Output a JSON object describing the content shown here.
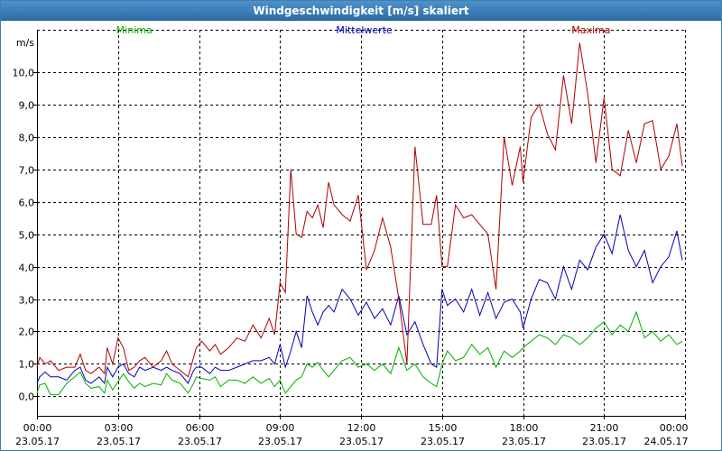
{
  "window": {
    "title": "Windgeschwindigkeit [m/s] skaliert"
  },
  "chart_data": {
    "type": "line",
    "title": "Windgeschwindigkeit [m/s] skaliert",
    "ylabel": "m/s",
    "xlabel": "",
    "ylim": [
      -0.6,
      11.3
    ],
    "xlim": [
      0,
      24
    ],
    "grid": true,
    "legend_position": "top",
    "yticks": [
      0,
      1,
      2,
      3,
      4,
      5,
      6,
      7,
      8,
      9,
      10
    ],
    "ytick_labels": [
      "0,0",
      "1,0",
      "2,0",
      "3,0",
      "4,0",
      "5,0",
      "6,0",
      "7,0",
      "8,0",
      "9,0",
      "10,0"
    ],
    "xticks": [
      0,
      3,
      6,
      9,
      12,
      15,
      18,
      21,
      24
    ],
    "xtick_labels": [
      {
        "time": "00:00",
        "date": "23.05.17"
      },
      {
        "time": "03:00",
        "date": "23.05.17"
      },
      {
        "time": "06:00",
        "date": "23.05.17"
      },
      {
        "time": "09:00",
        "date": "23.05.17"
      },
      {
        "time": "12:00",
        "date": "23.05.17"
      },
      {
        "time": "15:00",
        "date": "23.05.17"
      },
      {
        "time": "18:00",
        "date": "23.05.17"
      },
      {
        "time": "21:00",
        "date": "23.05.17"
      },
      {
        "time": "00:00",
        "date": "24.05.17"
      }
    ],
    "series": [
      {
        "name": "Minima",
        "color": "#00b000",
        "x": [
          0,
          0.1,
          0.3,
          0.5,
          0.8,
          1.1,
          1.4,
          1.6,
          1.8,
          2.0,
          2.3,
          2.5,
          2.6,
          2.8,
          3.0,
          3.2,
          3.4,
          3.6,
          3.8,
          4.0,
          4.3,
          4.6,
          4.8,
          5.0,
          5.3,
          5.6,
          5.8,
          5.9,
          6.1,
          6.4,
          6.6,
          6.8,
          7.1,
          7.4,
          7.7,
          8.0,
          8.3,
          8.6,
          8.8,
          9.0,
          9.2,
          9.4,
          9.6,
          9.8,
          10.0,
          10.2,
          10.4,
          10.6,
          10.8,
          11.0,
          11.3,
          11.6,
          11.9,
          12.2,
          12.5,
          12.8,
          13.1,
          13.4,
          13.7,
          14.0,
          14.3,
          14.6,
          14.8,
          15.0,
          15.2,
          15.5,
          15.8,
          16.1,
          16.4,
          16.7,
          17.0,
          17.3,
          17.6,
          17.9,
          18.0,
          18.3,
          18.6,
          18.9,
          19.2,
          19.5,
          19.8,
          20.1,
          20.4,
          20.7,
          21.0,
          21.3,
          21.6,
          21.9,
          22.2,
          22.5,
          22.8,
          23.1,
          23.4,
          23.7,
          23.9
        ],
        "values": [
          0.1,
          0.35,
          0.4,
          0.05,
          0.05,
          0.4,
          0.6,
          0.75,
          0.4,
          0.25,
          0.3,
          0.1,
          0.5,
          0.2,
          0.45,
          0.7,
          0.45,
          0.25,
          0.4,
          0.3,
          0.4,
          0.35,
          0.7,
          0.5,
          0.4,
          0.1,
          0.4,
          0.6,
          0.55,
          0.5,
          0.6,
          0.3,
          0.5,
          0.5,
          0.4,
          0.6,
          0.4,
          0.55,
          0.3,
          0.5,
          0.1,
          0.3,
          0.5,
          0.6,
          1.0,
          0.9,
          1.05,
          0.8,
          0.6,
          0.8,
          1.1,
          1.2,
          0.9,
          1.0,
          0.8,
          1.0,
          0.7,
          1.5,
          0.8,
          1.0,
          0.6,
          0.4,
          0.3,
          1.0,
          1.4,
          1.1,
          1.2,
          1.6,
          1.3,
          1.5,
          0.9,
          1.4,
          1.2,
          1.4,
          1.5,
          1.7,
          1.9,
          1.8,
          1.6,
          1.9,
          1.8,
          1.6,
          1.8,
          2.1,
          2.3,
          1.9,
          2.2,
          2.0,
          2.6,
          1.8,
          2.0,
          1.7,
          1.9,
          1.6,
          1.7
        ]
      },
      {
        "name": "Mittelwerte",
        "color": "#0000b8",
        "x": [
          0,
          0.1,
          0.3,
          0.5,
          0.8,
          1.1,
          1.4,
          1.6,
          1.8,
          2.0,
          2.3,
          2.5,
          2.6,
          2.8,
          3.0,
          3.2,
          3.4,
          3.6,
          3.8,
          4.0,
          4.3,
          4.6,
          4.8,
          5.0,
          5.3,
          5.6,
          5.8,
          5.9,
          6.1,
          6.4,
          6.6,
          6.8,
          7.1,
          7.4,
          7.7,
          8.0,
          8.3,
          8.6,
          8.8,
          9.0,
          9.2,
          9.4,
          9.6,
          9.8,
          10.0,
          10.2,
          10.4,
          10.6,
          10.8,
          11.0,
          11.3,
          11.6,
          11.9,
          12.2,
          12.5,
          12.8,
          13.1,
          13.4,
          13.7,
          14.0,
          14.3,
          14.6,
          14.8,
          15.0,
          15.2,
          15.5,
          15.8,
          16.1,
          16.4,
          16.7,
          17.0,
          17.3,
          17.6,
          17.9,
          18.0,
          18.3,
          18.6,
          18.9,
          19.2,
          19.5,
          19.8,
          20.1,
          20.4,
          20.7,
          21.0,
          21.3,
          21.6,
          21.9,
          22.2,
          22.5,
          22.8,
          23.1,
          23.4,
          23.7,
          23.9
        ],
        "values": [
          0.4,
          0.6,
          0.75,
          0.6,
          0.6,
          0.5,
          0.8,
          0.9,
          0.5,
          0.4,
          0.6,
          0.4,
          0.9,
          0.6,
          0.9,
          1.0,
          0.7,
          0.6,
          0.9,
          0.8,
          0.9,
          0.8,
          0.9,
          0.8,
          0.7,
          0.4,
          0.8,
          0.9,
          0.9,
          0.7,
          0.9,
          0.8,
          0.8,
          0.9,
          1.0,
          1.1,
          1.1,
          1.2,
          1.0,
          1.6,
          0.9,
          1.4,
          2.0,
          1.5,
          3.1,
          2.6,
          2.2,
          2.6,
          2.8,
          2.6,
          3.3,
          3.0,
          2.5,
          2.9,
          2.4,
          2.7,
          2.2,
          3.1,
          1.9,
          2.3,
          1.6,
          1.0,
          0.9,
          3.3,
          2.8,
          3.0,
          2.6,
          3.3,
          2.5,
          3.2,
          2.4,
          2.9,
          3.0,
          2.6,
          2.1,
          3.0,
          3.6,
          3.5,
          3.0,
          4.0,
          3.3,
          4.2,
          3.9,
          4.6,
          5.0,
          4.4,
          5.6,
          4.5,
          4.0,
          4.5,
          3.5,
          4.0,
          4.3,
          5.1,
          4.2
        ]
      },
      {
        "name": "Maxima",
        "color": "#b00000",
        "x": [
          0,
          0.1,
          0.3,
          0.5,
          0.8,
          1.1,
          1.4,
          1.6,
          1.8,
          2.0,
          2.3,
          2.5,
          2.6,
          2.8,
          3.0,
          3.2,
          3.4,
          3.6,
          3.8,
          4.0,
          4.3,
          4.6,
          4.8,
          5.0,
          5.3,
          5.6,
          5.8,
          5.9,
          6.1,
          6.4,
          6.6,
          6.8,
          7.1,
          7.4,
          7.7,
          8.0,
          8.3,
          8.6,
          8.8,
          9.0,
          9.2,
          9.4,
          9.6,
          9.8,
          10.0,
          10.2,
          10.4,
          10.6,
          10.8,
          11.0,
          11.3,
          11.6,
          11.9,
          12.2,
          12.5,
          12.8,
          13.1,
          13.4,
          13.7,
          14.0,
          14.3,
          14.6,
          14.8,
          15.0,
          15.2,
          15.5,
          15.8,
          16.1,
          16.4,
          16.7,
          17.0,
          17.3,
          17.6,
          17.9,
          18.0,
          18.3,
          18.6,
          18.9,
          19.2,
          19.5,
          19.8,
          20.1,
          20.4,
          20.7,
          21.0,
          21.3,
          21.6,
          21.9,
          22.2,
          22.5,
          22.8,
          23.1,
          23.4,
          23.7,
          23.9
        ],
        "values": [
          0.9,
          1.2,
          1.0,
          1.1,
          0.8,
          0.9,
          0.9,
          1.3,
          0.8,
          0.7,
          0.9,
          0.7,
          1.5,
          1.0,
          1.8,
          1.5,
          0.8,
          0.9,
          1.1,
          1.2,
          0.9,
          1.1,
          1.4,
          1.0,
          0.8,
          0.6,
          1.2,
          1.5,
          1.7,
          1.4,
          1.6,
          1.3,
          1.5,
          1.8,
          1.7,
          2.2,
          1.8,
          2.4,
          1.9,
          3.5,
          3.2,
          7.0,
          5.0,
          4.9,
          5.7,
          5.5,
          5.9,
          5.2,
          6.6,
          5.9,
          5.6,
          5.4,
          6.2,
          3.9,
          4.5,
          5.5,
          4.6,
          3.0,
          1.0,
          7.7,
          5.3,
          5.3,
          6.2,
          4.0,
          4.0,
          5.9,
          5.5,
          5.6,
          5.3,
          5.0,
          3.3,
          8.0,
          6.5,
          7.7,
          6.6,
          8.6,
          9.0,
          8.1,
          7.6,
          9.9,
          8.4,
          10.9,
          9.3,
          7.2,
          9.2,
          7.0,
          6.8,
          8.2,
          7.2,
          8.4,
          8.5,
          7.0,
          7.4,
          8.4,
          7.1
        ]
      }
    ]
  }
}
